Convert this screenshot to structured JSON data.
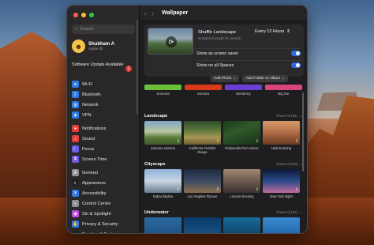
{
  "window_title": "Wallpaper",
  "sidebar": {
    "search_placeholder": "Search",
    "user": {
      "name": "Shubham A",
      "sub": "Apple ID"
    },
    "update": {
      "label": "Software Update Available",
      "count": "1"
    },
    "group1": [
      {
        "label": "Wi-Fi",
        "icon": "wifi-icon",
        "color": "#2d7be6",
        "glyph": "≋"
      },
      {
        "label": "Bluetooth",
        "icon": "bluetooth-icon",
        "color": "#2d7be6",
        "glyph": "ᛒ"
      },
      {
        "label": "Network",
        "icon": "network-icon",
        "color": "#2d7be6",
        "glyph": "◍"
      },
      {
        "label": "VPN",
        "icon": "vpn-icon",
        "color": "#2d7be6",
        "glyph": "◈"
      }
    ],
    "group2": [
      {
        "label": "Notifications",
        "icon": "notifications-icon",
        "color": "#e0413c",
        "glyph": "●"
      },
      {
        "label": "Sound",
        "icon": "sound-icon",
        "color": "#e0413c",
        "glyph": "♪"
      },
      {
        "label": "Focus",
        "icon": "focus-icon",
        "color": "#6b5be0",
        "glyph": "☾"
      },
      {
        "label": "Screen Time",
        "icon": "screen-time-icon",
        "color": "#6b5be0",
        "glyph": "⧗"
      }
    ],
    "group3": [
      {
        "label": "General",
        "icon": "general-icon",
        "color": "#8e8e93",
        "glyph": "⚙"
      },
      {
        "label": "Appearance",
        "icon": "appearance-icon",
        "color": "#222",
        "glyph": "◐"
      },
      {
        "label": "Accessibility",
        "icon": "accessibility-icon",
        "color": "#2d7be6",
        "glyph": "♿"
      },
      {
        "label": "Control Centre",
        "icon": "control-centre-icon",
        "color": "#8e8e93",
        "glyph": "≡"
      },
      {
        "label": "Siri & Spotlight",
        "icon": "siri-icon",
        "color": "#c04ae0",
        "glyph": "◉"
      },
      {
        "label": "Privacy & Security",
        "icon": "privacy-icon",
        "color": "#2d7be6",
        "glyph": "✋"
      },
      {
        "label": "Desktop & Dock",
        "icon": "desktop-dock-icon",
        "color": "#222",
        "glyph": "▭"
      }
    ]
  },
  "current": {
    "title": "Shuffle Landscape",
    "subtitle": "Rotates through 61 aerials",
    "frequency": "Every 12 Hours",
    "options": [
      {
        "label": "Show as screen saver",
        "on": true
      },
      {
        "label": "Show on all Spaces",
        "on": true
      }
    ]
  },
  "buttons": {
    "add_photo": "Add Photo",
    "add_folder": "Add Folder or Album"
  },
  "dynamic": [
    {
      "label": "Sonoma",
      "color": "#6bbf3a"
    },
    {
      "label": "Ventura",
      "color": "#d83a1a"
    },
    {
      "label": "Monterey",
      "color": "#6b3fd6"
    },
    {
      "label": "Big Sur",
      "color": "#d9457a"
    }
  ],
  "sections": [
    {
      "title": "Landscape",
      "show_all": "Show All (61)",
      "items": [
        {
          "caption": "Sonoma Horizon",
          "bg": "linear-gradient(180deg,#7fa7c7 0%,#b8c6a0 45%,#5a7a3a 70%,#3e5a28 100%)"
        },
        {
          "caption": "California Temblor Range",
          "bg": "linear-gradient(180deg,#2e4a2a 0%,#5c7a3c 40%,#a89454 70%,#6a5a30 100%)"
        },
        {
          "caption": "Redwoods from Above",
          "bg": "linear-gradient(160deg,#1e3a1e 0%,#2f5a2a 40%,#183018 100%)"
        },
        {
          "caption": "Utah Evening",
          "bg": "linear-gradient(180deg,#d89a6a 0%,#b5704a 45%,#6a3a20 100%)"
        }
      ]
    },
    {
      "title": "Cityscape",
      "show_all": "Show All (30)",
      "items": [
        {
          "caption": "Dubai Skyline",
          "bg": "linear-gradient(180deg,#8fb3d9 0%,#c9d5e2 50%,#6a7b8f 100%)"
        },
        {
          "caption": "Los Angeles Flyover",
          "bg": "linear-gradient(180deg,#1e2a3e 0%,#3c4a63 50%,#8a7050 100%)"
        },
        {
          "caption": "London Evening",
          "bg": "linear-gradient(180deg,#a28870 0%,#6c5a50 50%,#3a3030 100%)"
        },
        {
          "caption": "New York Night",
          "bg": "linear-gradient(180deg,#0e1a36 0%,#2a4a8a 50%,#c06a9a 100%)"
        }
      ]
    },
    {
      "title": "Underwater",
      "show_all": "Show All (27)",
      "items": [
        {
          "caption": "",
          "bg": "linear-gradient(180deg,#2c6aa0 0%,#1a4a7a 100%)"
        },
        {
          "caption": "",
          "bg": "linear-gradient(180deg,#0c3a6a 0%,#1a5a8a 100%)"
        },
        {
          "caption": "",
          "bg": "linear-gradient(180deg,#1a6a9a 0%,#0a3a5a 100%)"
        },
        {
          "caption": "",
          "bg": "linear-gradient(180deg,#3a8ad0 0%,#1a5aa0 100%)"
        }
      ]
    }
  ]
}
